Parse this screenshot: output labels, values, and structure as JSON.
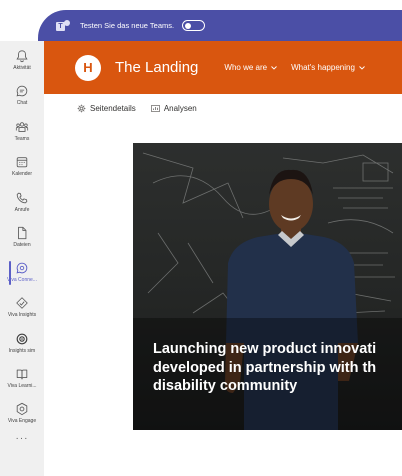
{
  "banner": {
    "text": "Testen Sie das neue Teams."
  },
  "rail": {
    "items": [
      {
        "label": "Aktivität",
        "icon": "bell-icon"
      },
      {
        "label": "Chat",
        "icon": "chat-icon"
      },
      {
        "label": "Teams",
        "icon": "teams-icon"
      },
      {
        "label": "Kalender",
        "icon": "calendar-icon"
      },
      {
        "label": "Anrufe",
        "icon": "phone-icon"
      },
      {
        "label": "Dateien",
        "icon": "file-icon"
      },
      {
        "label": "Viva Conne...",
        "icon": "viva-connections-icon"
      },
      {
        "label": "Viva Insights",
        "icon": "viva-insights-icon"
      },
      {
        "label": "Insights sim",
        "icon": "insights-sim-icon"
      },
      {
        "label": "Viva Learni...",
        "icon": "viva-learning-icon"
      },
      {
        "label": "Viva Engage",
        "icon": "viva-engage-icon"
      }
    ],
    "more": "···"
  },
  "site": {
    "logo_letter": "H",
    "title": "The Landing",
    "nav": [
      {
        "label": "Who we are"
      },
      {
        "label": "What's happening"
      }
    ]
  },
  "commands": {
    "page_details": "Seitendetails",
    "analytics": "Analysen"
  },
  "hero": {
    "caption_lines": [
      "Launching new product innovati",
      "developed in partnership with th",
      "disability community"
    ]
  },
  "colors": {
    "banner": "#4b4fa6",
    "site_header": "#d9560f",
    "rail_bg": "#f0f0f0",
    "active": "#5b5fc7"
  }
}
